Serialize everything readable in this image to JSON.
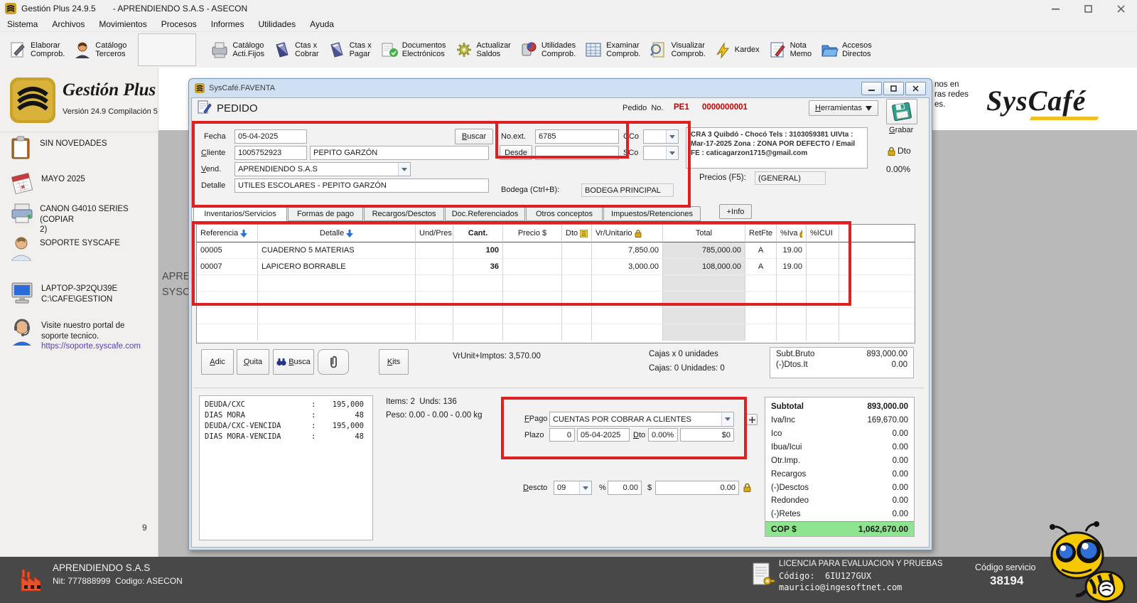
{
  "colors": {
    "accent_red": "#c80000",
    "highlight_red": "#e02020",
    "total_green": "#8fe48f",
    "brand_gold": "#c9a227"
  },
  "titlebar": {
    "title": "Gestión Plus 24.9.5",
    "subtitle": "- APRENDIENDO S.A.S - ASECON"
  },
  "menubar": {
    "items": [
      "Sistema",
      "Archivos",
      "Movimientos",
      "Procesos",
      "Informes",
      "Utilidades",
      "Ayuda"
    ]
  },
  "toolbar": {
    "buttons": [
      {
        "line1": "Elaborar",
        "line2": "Comprob."
      },
      {
        "line1": "Catálogo",
        "line2": "Terceros"
      },
      {
        "line1": "Catálogo",
        "line2": "Acti.Fijos"
      },
      {
        "line1": "Ctas x",
        "line2": "Cobrar"
      },
      {
        "line1": "Ctas x",
        "line2": "Pagar"
      },
      {
        "line1": "Documentos",
        "line2": "Electrónicos"
      },
      {
        "line1": "Actualizar",
        "line2": "Saldos"
      },
      {
        "line1": "Utilidades",
        "line2": "Comprob."
      },
      {
        "line1": "Examinar",
        "line2": "Comprob."
      },
      {
        "line1": "Visualizar",
        "line2": "Comprob."
      },
      {
        "line1": "Kardex",
        "line2": ""
      },
      {
        "line1": "Nota",
        "line2": "Memo"
      },
      {
        "line1": "Accesos",
        "line2": "Directos"
      }
    ]
  },
  "sidebar": {
    "logo_title": "Gestión Plus",
    "logo_subtitle": "Versión 24.9 Compilación 5",
    "items": [
      {
        "l1": "SIN NOVEDADES",
        "l2": ""
      },
      {
        "l1": "MAYO 2025",
        "l2": ""
      },
      {
        "l1": "CANON G4010 SERIES (COPIAR",
        "l2": "2)"
      },
      {
        "l1": "SOPORTE SYSCAFE",
        "l2": ""
      },
      {
        "l1": "LAPTOP-3P2QU39E",
        "l2": "C:\\CAFE\\GESTION"
      },
      {
        "l1": "Visite nuestro portal de",
        "l2": "soporte tecnico.",
        "link": "https://soporte.syscafe.com"
      }
    ],
    "counter": "9"
  },
  "background": {
    "band_line1": "APRE",
    "band_line2": "SYSC",
    "frag_line1": "nos en",
    "frag_line2": "ras redes",
    "frag_line3": "es.",
    "syscafe_logo": "SysCafé"
  },
  "window": {
    "title": "SysCafé.FAVENTA",
    "header": {
      "doc_type": "PEDIDO",
      "pedido_label": "Pedido  No.",
      "prefix": "PE1",
      "number": "0000000001",
      "herramientas": "Herramientas",
      "grabar": "Grabar"
    },
    "form": {
      "fecha_label": "Fecha",
      "fecha_value": "05-04-2025",
      "buscar_label": "Buscar",
      "cliente_label": "Cliente",
      "cliente_id": "1005752923",
      "cliente_name": "PEPITO GARZÓN",
      "vend_label": "Vend.",
      "vend_value": "APRENDIENDO S.A.S",
      "detalle_label": "Detalle",
      "detalle_value": "UTILES ESCOLARES - PEPITO GARZÓN",
      "noext_label": "No.ext.",
      "noext_value": "6785",
      "desde_label": "Desde",
      "desde_value": "",
      "cco_label": "CCo",
      "sco_label": "SCo",
      "info_text": "CRA 3 Quibdó - Chocó Tels : 3103059381 UIVta : Mar-17-2025 Zona : ZONA POR DEFECTO / Email FE : caticagarzon1715@gmail.com",
      "precios_label": "Precios (F5):",
      "precios_value": "(GENERAL)",
      "dto_label": "Dto",
      "dto_value": "0.00%",
      "bodega_label": "Bodega (Ctrl+B):",
      "bodega_value": "BODEGA PRINCIPAL"
    },
    "tabs": [
      "Inventarios/Servicios",
      "Formas de pago",
      "Recargos/Desctos",
      "Doc.Referenciados",
      "Otros conceptos",
      "Impuestos/Retenciones"
    ],
    "info_tab": "+Info",
    "table": {
      "columns": [
        "Referencia",
        "Detalle",
        "Und/Pres",
        "Cant.",
        "Precio $",
        "Dto",
        "Vr/Unitario",
        "Total",
        "RetFte",
        "%Iva",
        "%ICUI"
      ],
      "rows": [
        {
          "ref": "00005",
          "detalle": "CUADERNO 5 MATERIAS",
          "und": "",
          "cant": "100",
          "precio": "",
          "dto": "",
          "vr": "7,850.00",
          "total": "785,000.00",
          "retfte": "A",
          "iva": "19.00",
          "icui": ""
        },
        {
          "ref": "00007",
          "detalle": "LAPICERO BORRABLE",
          "und": "",
          "cant": "36",
          "precio": "",
          "dto": "",
          "vr": "3,000.00",
          "total": "108,000.00",
          "retfte": "A",
          "iva": "19.00",
          "icui": ""
        }
      ]
    },
    "actions": {
      "adic": "Adic",
      "quita": "Quita",
      "busca": "Busca",
      "kits": "Kits"
    },
    "mid": {
      "vrunit": "VrUnit+Imptos: 3,570.00",
      "cajas1": "Cajas x 0 unidades",
      "cajas2": "Cajas: 0 Unidades: 0",
      "subt_bruto_label": "Subt.Bruto",
      "subt_bruto_value": "893,000.00",
      "dtos_it_label": "(-)Dtos.It",
      "dtos_it_value": "0.00"
    },
    "deuda": {
      "rows": [
        {
          "label": "DEUDA/CXC",
          "value": "195,000"
        },
        {
          "label": "DIAS MORA",
          "value": "48"
        },
        {
          "label": "DEUDA/CXC-VENCIDA",
          "value": "195,000"
        },
        {
          "label": "DIAS MORA-VENCIDA",
          "value": "48"
        }
      ]
    },
    "items_line": "Items: 2  Unds: 136",
    "peso_line": "Peso: 0.00 - 0.00 - 0.00 kg",
    "fpago": {
      "label": "FPago",
      "value": "CUENTAS POR COBRAR A CLIENTES",
      "plazo_label": "Plazo",
      "plazo_value": "0",
      "plazo_date": "05-04-2025",
      "dto_label": "Dto",
      "dto_value": "0.00%",
      "amount": "$0"
    },
    "descto": {
      "label": "Descto",
      "code": "09",
      "pct_label": "%",
      "pct_value": "0.00",
      "usd_label": "$",
      "usd_value": "0.00"
    },
    "summary": {
      "rows": [
        {
          "label": "Subtotal",
          "value": "893,000.00"
        },
        {
          "label": "Iva/Inc",
          "value": "169,670.00"
        },
        {
          "label": "Ico",
          "value": "0.00"
        },
        {
          "label": "Ibua/Icui",
          "value": "0.00"
        },
        {
          "label": "Otr.Imp.",
          "value": "0.00"
        },
        {
          "label": "Recargos",
          "value": "0.00"
        },
        {
          "label": "(-)Desctos",
          "value": "0.00"
        },
        {
          "label": "Redondeo",
          "value": "0.00"
        },
        {
          "label": "(-)Retes",
          "value": "0.00"
        }
      ],
      "total_label": "COP $",
      "total_value": "1,062,670.00"
    }
  },
  "statusbar": {
    "company": "APRENDIENDO S.A.S",
    "nit_line": "Nit: 777888999  Codigo: ASECON",
    "licencia_line1": "LICENCIA PARA EVALUACION Y PRUEBAS",
    "licencia_line2": "Código:  6IU127GUX",
    "licencia_line3": "mauricio@ingesoftnet.com",
    "servicio_label": "Código servicio",
    "servicio_value": "38194"
  }
}
